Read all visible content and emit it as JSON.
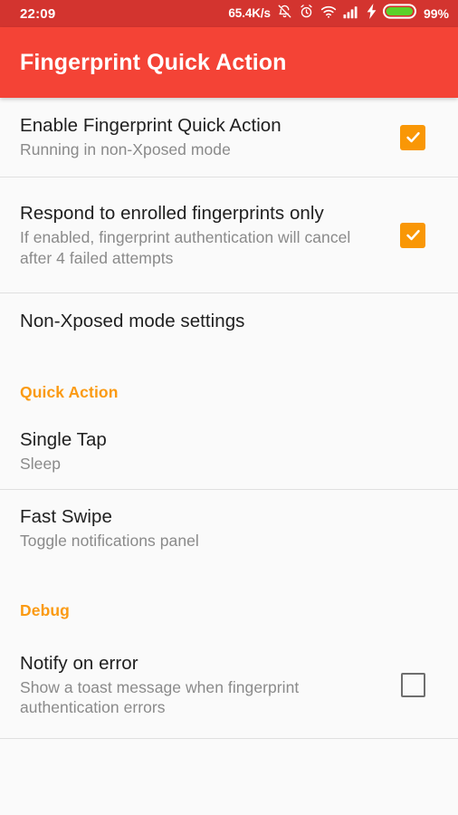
{
  "status_bar": {
    "clock": "22:09",
    "network_speed": "65.4K/s",
    "battery_percent": "99%",
    "icons": [
      "notifications-muted-icon",
      "alarm-clock-icon",
      "wifi-icon",
      "cellular-signal-icon",
      "charging-bolt-icon",
      "battery-icon"
    ],
    "colors": {
      "background": "#D3342F",
      "foreground": "#FFFFFF",
      "battery_fill": "#5BD12A"
    }
  },
  "app_bar": {
    "title": "Fingerprint Quick Action",
    "background": "#F44336",
    "title_color": "#FFFFFF"
  },
  "theme": {
    "accent": "#FB9A12",
    "checkbox_checked": "#F99706",
    "checkbox_unchecked_border": "#6E6E6E",
    "page_background": "#FAFAFA",
    "divider": "#E0E0E0",
    "title_text": "#202020",
    "summary_text": "#8A8A8A"
  },
  "preferences": [
    {
      "title": "Enable Fingerprint Quick Action",
      "summary": "Running in non-Xposed mode",
      "widget": "checkbox",
      "checked": true
    },
    {
      "title": "Respond to enrolled fingerprints only",
      "summary": "If enabled, fingerprint authentication will cancel after 4 failed attempts",
      "widget": "checkbox",
      "checked": true
    },
    {
      "title": "Non-Xposed mode settings",
      "summary": "",
      "widget": "none"
    },
    {
      "title": "Single Tap",
      "summary": "Sleep",
      "widget": "none"
    },
    {
      "title": "Fast Swipe",
      "summary": "Toggle notifications panel",
      "widget": "none"
    },
    {
      "title": "Notify on error",
      "summary": "Show a toast message when fingerprint authentication errors",
      "widget": "checkbox",
      "checked": false
    }
  ],
  "categories": {
    "quick_action": "Quick Action",
    "debug": "Debug"
  }
}
